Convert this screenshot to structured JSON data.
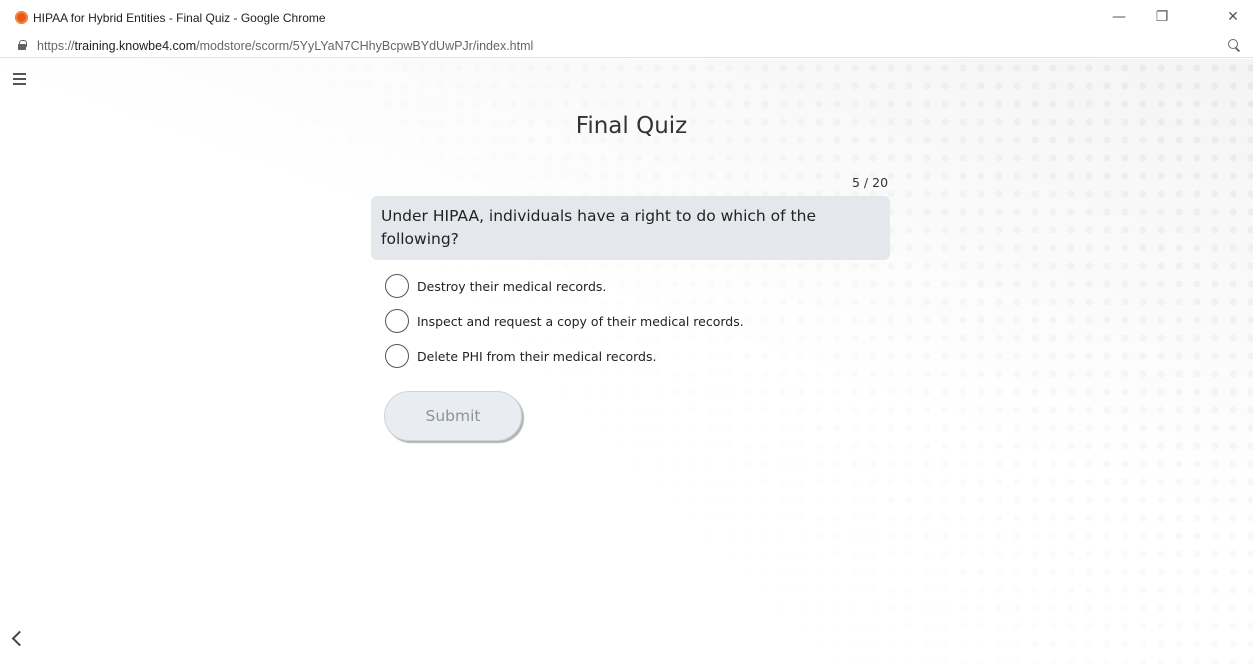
{
  "window": {
    "title": "HIPAA for Hybrid Entities - Final Quiz - Google Chrome",
    "minimize_icon": "minimize-icon",
    "maximize_icon": "restore-icon",
    "close_icon": "close-icon",
    "minimize_glyph": "—",
    "maximize_glyph": "❐",
    "close_glyph": "✕"
  },
  "address_bar": {
    "scheme": "https://",
    "domain": "training.knowbe4.com",
    "path": "/modstore/scorm/5YyLYaN7CHhyBcpwBYdUwPJr/index.html",
    "lock_icon": "lock-icon",
    "zoom_icon": "zoom-icon"
  },
  "quiz": {
    "title": "Final Quiz",
    "counter": "5 / 20",
    "question": "Under HIPAA, individuals have a right to do which of the following?",
    "options": [
      "Destroy their medical records.",
      "Inspect and request a copy of their medical records.",
      "Delete PHI from their medical records."
    ],
    "submit_label": "Submit"
  },
  "nav": {
    "menu_icon": "hamburger-menu-icon",
    "back_icon": "chevron-left-icon"
  }
}
